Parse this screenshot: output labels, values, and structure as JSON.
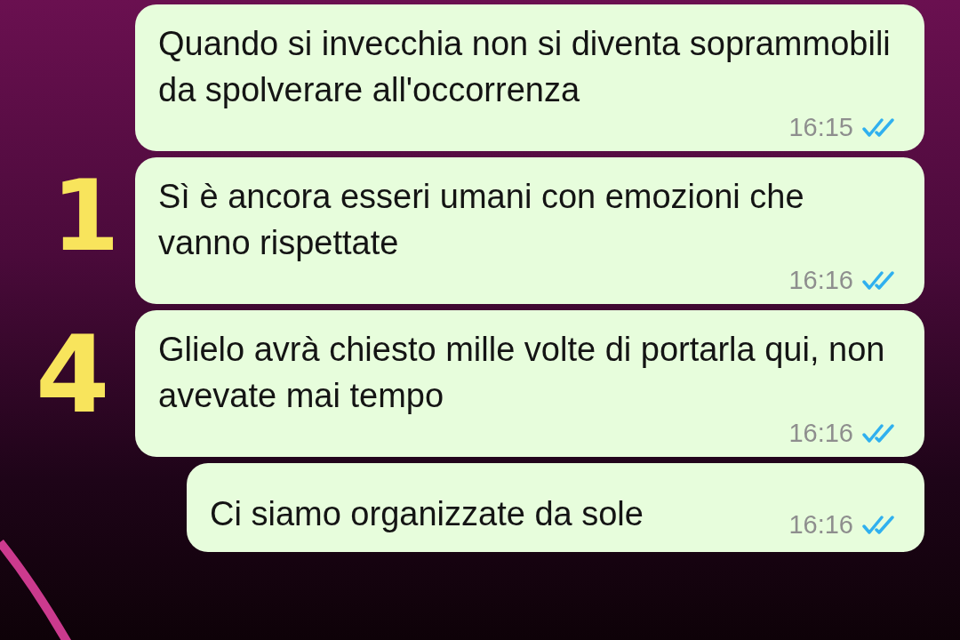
{
  "messages": [
    {
      "kind": "wrapped",
      "text": "Quando si invecchia non si diventa soprammobili da spolverare all'occorrenza",
      "time": "16:15",
      "read": true
    },
    {
      "kind": "wrapped",
      "text": "Sì è ancora esseri umani con emozioni che vanno rispettate",
      "time": "16:16",
      "read": true
    },
    {
      "kind": "wrapped",
      "text": "Glielo avrà chiesto mille volte di portarla qui, non avevate mai tempo",
      "time": "16:16",
      "read": true
    },
    {
      "kind": "short",
      "text": "Ci siamo organizzate da sole",
      "time": "16:16",
      "read": true
    }
  ],
  "annotations": [
    "1",
    "4"
  ]
}
